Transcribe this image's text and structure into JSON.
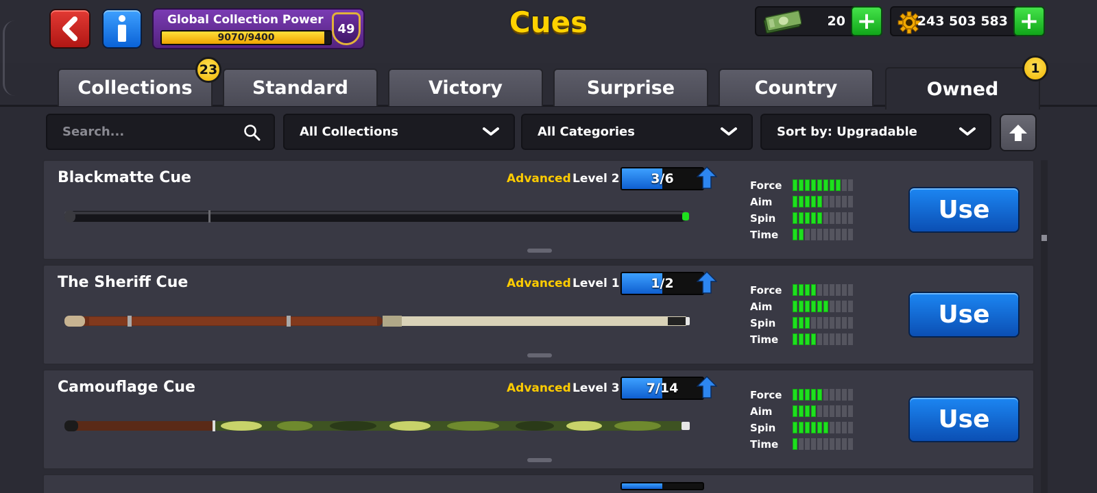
{
  "header": {
    "title": "Cues",
    "back_icon": "back-arrow-icon",
    "info_icon": "info-icon",
    "power": {
      "label": "Global Collection Power",
      "progress_text": "9070/9400",
      "current": 9070,
      "max": 9400,
      "level": "49"
    },
    "cash": {
      "icon": "cash-icon",
      "value": "20"
    },
    "coins": {
      "icon": "coins-icon",
      "value": "243 503 583"
    }
  },
  "tabs": [
    {
      "label": "Collections",
      "badge": "23"
    },
    {
      "label": "Standard"
    },
    {
      "label": "Victory"
    },
    {
      "label": "Surprise"
    },
    {
      "label": "Country"
    },
    {
      "label": "Owned",
      "badge": "1",
      "active": true
    }
  ],
  "filters": {
    "search_placeholder": "Search...",
    "collection": "All Collections",
    "category": "All Categories",
    "sort": "Sort by: Upgradable"
  },
  "stat_labels": [
    "Force",
    "Aim",
    "Spin",
    "Time"
  ],
  "cues": [
    {
      "name": "Blackmatte Cue",
      "rarity": "Advanced",
      "level": "Level 2",
      "progress": "3/6",
      "current": 3,
      "max": 6,
      "style": "blackmatte",
      "stats": [
        8,
        5,
        5,
        2
      ],
      "use_label": "Use"
    },
    {
      "name": "The Sheriff Cue",
      "rarity": "Advanced",
      "level": "Level 1",
      "progress": "1/2",
      "current": 1,
      "max": 2,
      "style": "sheriff",
      "stats": [
        4,
        6,
        3,
        4
      ],
      "use_label": "Use"
    },
    {
      "name": "Camouflage Cue",
      "rarity": "Advanced",
      "level": "Level 3",
      "progress": "7/14",
      "current": 7,
      "max": 14,
      "style": "camouflage",
      "stats": [
        5,
        4,
        6,
        1
      ],
      "use_label": "Use"
    }
  ],
  "colors": {
    "title": "#ffd200",
    "rarity": "#ffcc00",
    "stat_on": "#1ee01e",
    "use_button": "#1c86f2",
    "background": "#2b2b34"
  }
}
